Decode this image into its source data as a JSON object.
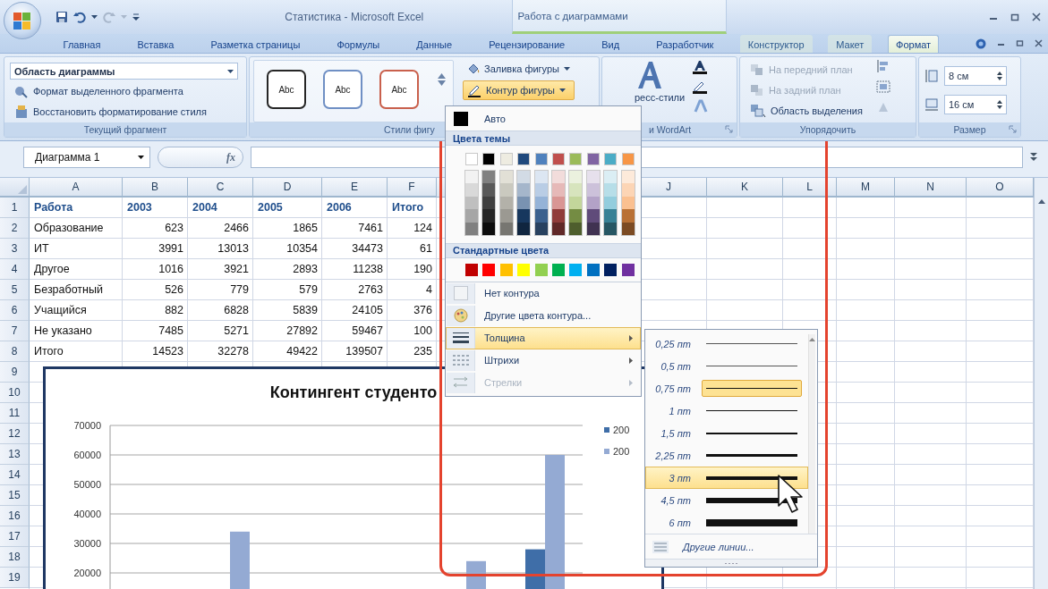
{
  "window": {
    "title": "Статистика - Microsoft Excel",
    "context_title": "Работа с диаграммами"
  },
  "tabs": [
    {
      "label": "Главная",
      "selected": false,
      "contextual": false
    },
    {
      "label": "Вставка",
      "selected": false,
      "contextual": false
    },
    {
      "label": "Разметка страницы",
      "selected": false,
      "contextual": false
    },
    {
      "label": "Формулы",
      "selected": false,
      "contextual": false
    },
    {
      "label": "Данные",
      "selected": false,
      "contextual": false
    },
    {
      "label": "Рецензирование",
      "selected": false,
      "contextual": false
    },
    {
      "label": "Вид",
      "selected": false,
      "contextual": false
    },
    {
      "label": "Разработчик",
      "selected": false,
      "contextual": false
    },
    {
      "label": "Конструктор",
      "selected": false,
      "contextual": true
    },
    {
      "label": "Макет",
      "selected": false,
      "contextual": true
    },
    {
      "label": "Формат",
      "selected": true,
      "contextual": true
    }
  ],
  "ribbon": {
    "current_selection": {
      "label": "Текущий фрагмент",
      "dropdown": "Область диаграммы",
      "actions": [
        "Формат выделенного фрагмента",
        "Восстановить форматирование стиля"
      ]
    },
    "shape_styles": {
      "label": "Стили фигу",
      "previews": [
        {
          "text": "Abc",
          "color": "#262626"
        },
        {
          "text": "Abc",
          "color": "#6f8fc4"
        },
        {
          "text": "Abc",
          "color": "#c9604c"
        }
      ],
      "fill_button": {
        "label": "Заливка фигуры",
        "active": false
      },
      "outline_button": {
        "label": "Контур фигуры",
        "active": true
      }
    },
    "wordart": {
      "label": "и WordArt",
      "quick_styles": "ресс-стили"
    },
    "arrange": {
      "label": "Упорядочить",
      "buttons": [
        {
          "label": "На передний план",
          "disabled": true
        },
        {
          "label": "На задний план",
          "disabled": true
        },
        {
          "label": "Область выделения",
          "disabled": false
        }
      ]
    },
    "size": {
      "label": "Размер",
      "height": "8 см",
      "width": "16 см"
    }
  },
  "formula_bar": {
    "name_box": "Диаграмма 1",
    "function_label": "fx"
  },
  "sheet": {
    "columns_left": [
      "A",
      "B",
      "C",
      "D",
      "E",
      "F"
    ],
    "columns_right": [
      "J",
      "K",
      "L",
      "M",
      "N",
      "O"
    ],
    "rows": [
      {
        "number": "1",
        "header": true,
        "cells": [
          "Работа",
          "2003",
          "2004",
          "2005",
          "2006",
          "Итого"
        ]
      },
      {
        "number": "2",
        "header": false,
        "cells": [
          "Образование",
          "623",
          "2466",
          "1865",
          "7461",
          "124"
        ]
      },
      {
        "number": "3",
        "header": false,
        "cells": [
          "ИТ",
          "3991",
          "13013",
          "10354",
          "34473",
          "61"
        ]
      },
      {
        "number": "4",
        "header": false,
        "cells": [
          "Другое",
          "1016",
          "3921",
          "2893",
          "11238",
          "190"
        ]
      },
      {
        "number": "5",
        "header": false,
        "cells": [
          "Безработный",
          "526",
          "779",
          "579",
          "2763",
          "4"
        ]
      },
      {
        "number": "6",
        "header": false,
        "cells": [
          "Учащийся",
          "882",
          "6828",
          "5839",
          "24105",
          "376"
        ]
      },
      {
        "number": "7",
        "header": false,
        "cells": [
          "Не указано",
          "7485",
          "5271",
          "27892",
          "59467",
          "100"
        ]
      },
      {
        "number": "8",
        "header": false,
        "cells": [
          "Итого",
          "14523",
          "32278",
          "49422",
          "139507",
          "235"
        ]
      }
    ],
    "more_row_numbers": [
      "9",
      "10",
      "11",
      "12",
      "13",
      "14",
      "15",
      "16",
      "17",
      "18",
      "19"
    ]
  },
  "chart": {
    "title": "Контингент студенто",
    "chart_data": {
      "type": "bar",
      "grid": true,
      "ylim": [
        0,
        70000
      ],
      "yticks": [
        20000,
        30000,
        40000,
        50000,
        60000,
        70000
      ],
      "series": [
        {
          "name": "200",
          "color": "#3f6ea8",
          "values": [
            null,
            null,
            null,
            null,
            null,
            28000
          ]
        },
        {
          "name": "200",
          "color": "#94aad3",
          "values": [
            null,
            34000,
            null,
            null,
            24000,
            60000
          ]
        }
      ]
    }
  },
  "outline_menu": {
    "auto": "Авто",
    "theme_header": "Цвета темы",
    "standard_header": "Стандартные цвета",
    "theme_colors": [
      {
        "color": "#ffffff"
      },
      {
        "color": "#000000"
      },
      {
        "color": "#eeece1"
      },
      {
        "color": "#1f497d"
      },
      {
        "color": "#4f81bd"
      },
      {
        "color": "#c0504d"
      },
      {
        "color": "#9bbb59"
      },
      {
        "color": "#8064a2"
      },
      {
        "color": "#4bacc6"
      },
      {
        "color": "#f79646"
      }
    ],
    "standard_colors": [
      {
        "color": "#c00000"
      },
      {
        "color": "#ff0000"
      },
      {
        "color": "#ffc000"
      },
      {
        "color": "#ffff00"
      },
      {
        "color": "#92d050"
      },
      {
        "color": "#00b050"
      },
      {
        "color": "#00b0f0"
      },
      {
        "color": "#0070c0"
      },
      {
        "color": "#002060"
      },
      {
        "color": "#7030a0"
      }
    ],
    "items": [
      {
        "label": "Нет контура",
        "kind": "plain",
        "highlighted": false,
        "disabled": false
      },
      {
        "label": "Другие цвета контура...",
        "kind": "plain",
        "highlighted": false,
        "disabled": false
      },
      {
        "label": "Толщина",
        "kind": "submenu",
        "highlighted": true,
        "disabled": false
      },
      {
        "label": "Штрихи",
        "kind": "submenu",
        "highlighted": false,
        "disabled": false
      },
      {
        "label": "Стрелки",
        "kind": "submenu",
        "highlighted": false,
        "disabled": true
      }
    ]
  },
  "weight_menu": {
    "items": [
      {
        "label": "0,25 пт",
        "selected": false,
        "highlighted": false
      },
      {
        "label": "0,5 пт",
        "selected": false,
        "highlighted": false
      },
      {
        "label": "0,75 пт",
        "selected": true,
        "highlighted": false
      },
      {
        "label": "1 пт",
        "selected": false,
        "highlighted": false
      },
      {
        "label": "1,5 пт",
        "selected": false,
        "highlighted": false
      },
      {
        "label": "2,25 пт",
        "selected": false,
        "highlighted": false
      },
      {
        "label": "3 пт",
        "selected": false,
        "highlighted": true
      },
      {
        "label": "4,5 пт",
        "selected": false,
        "highlighted": false
      },
      {
        "label": "6 пт",
        "selected": false,
        "highlighted": false
      }
    ],
    "more": "Другие линии..."
  }
}
